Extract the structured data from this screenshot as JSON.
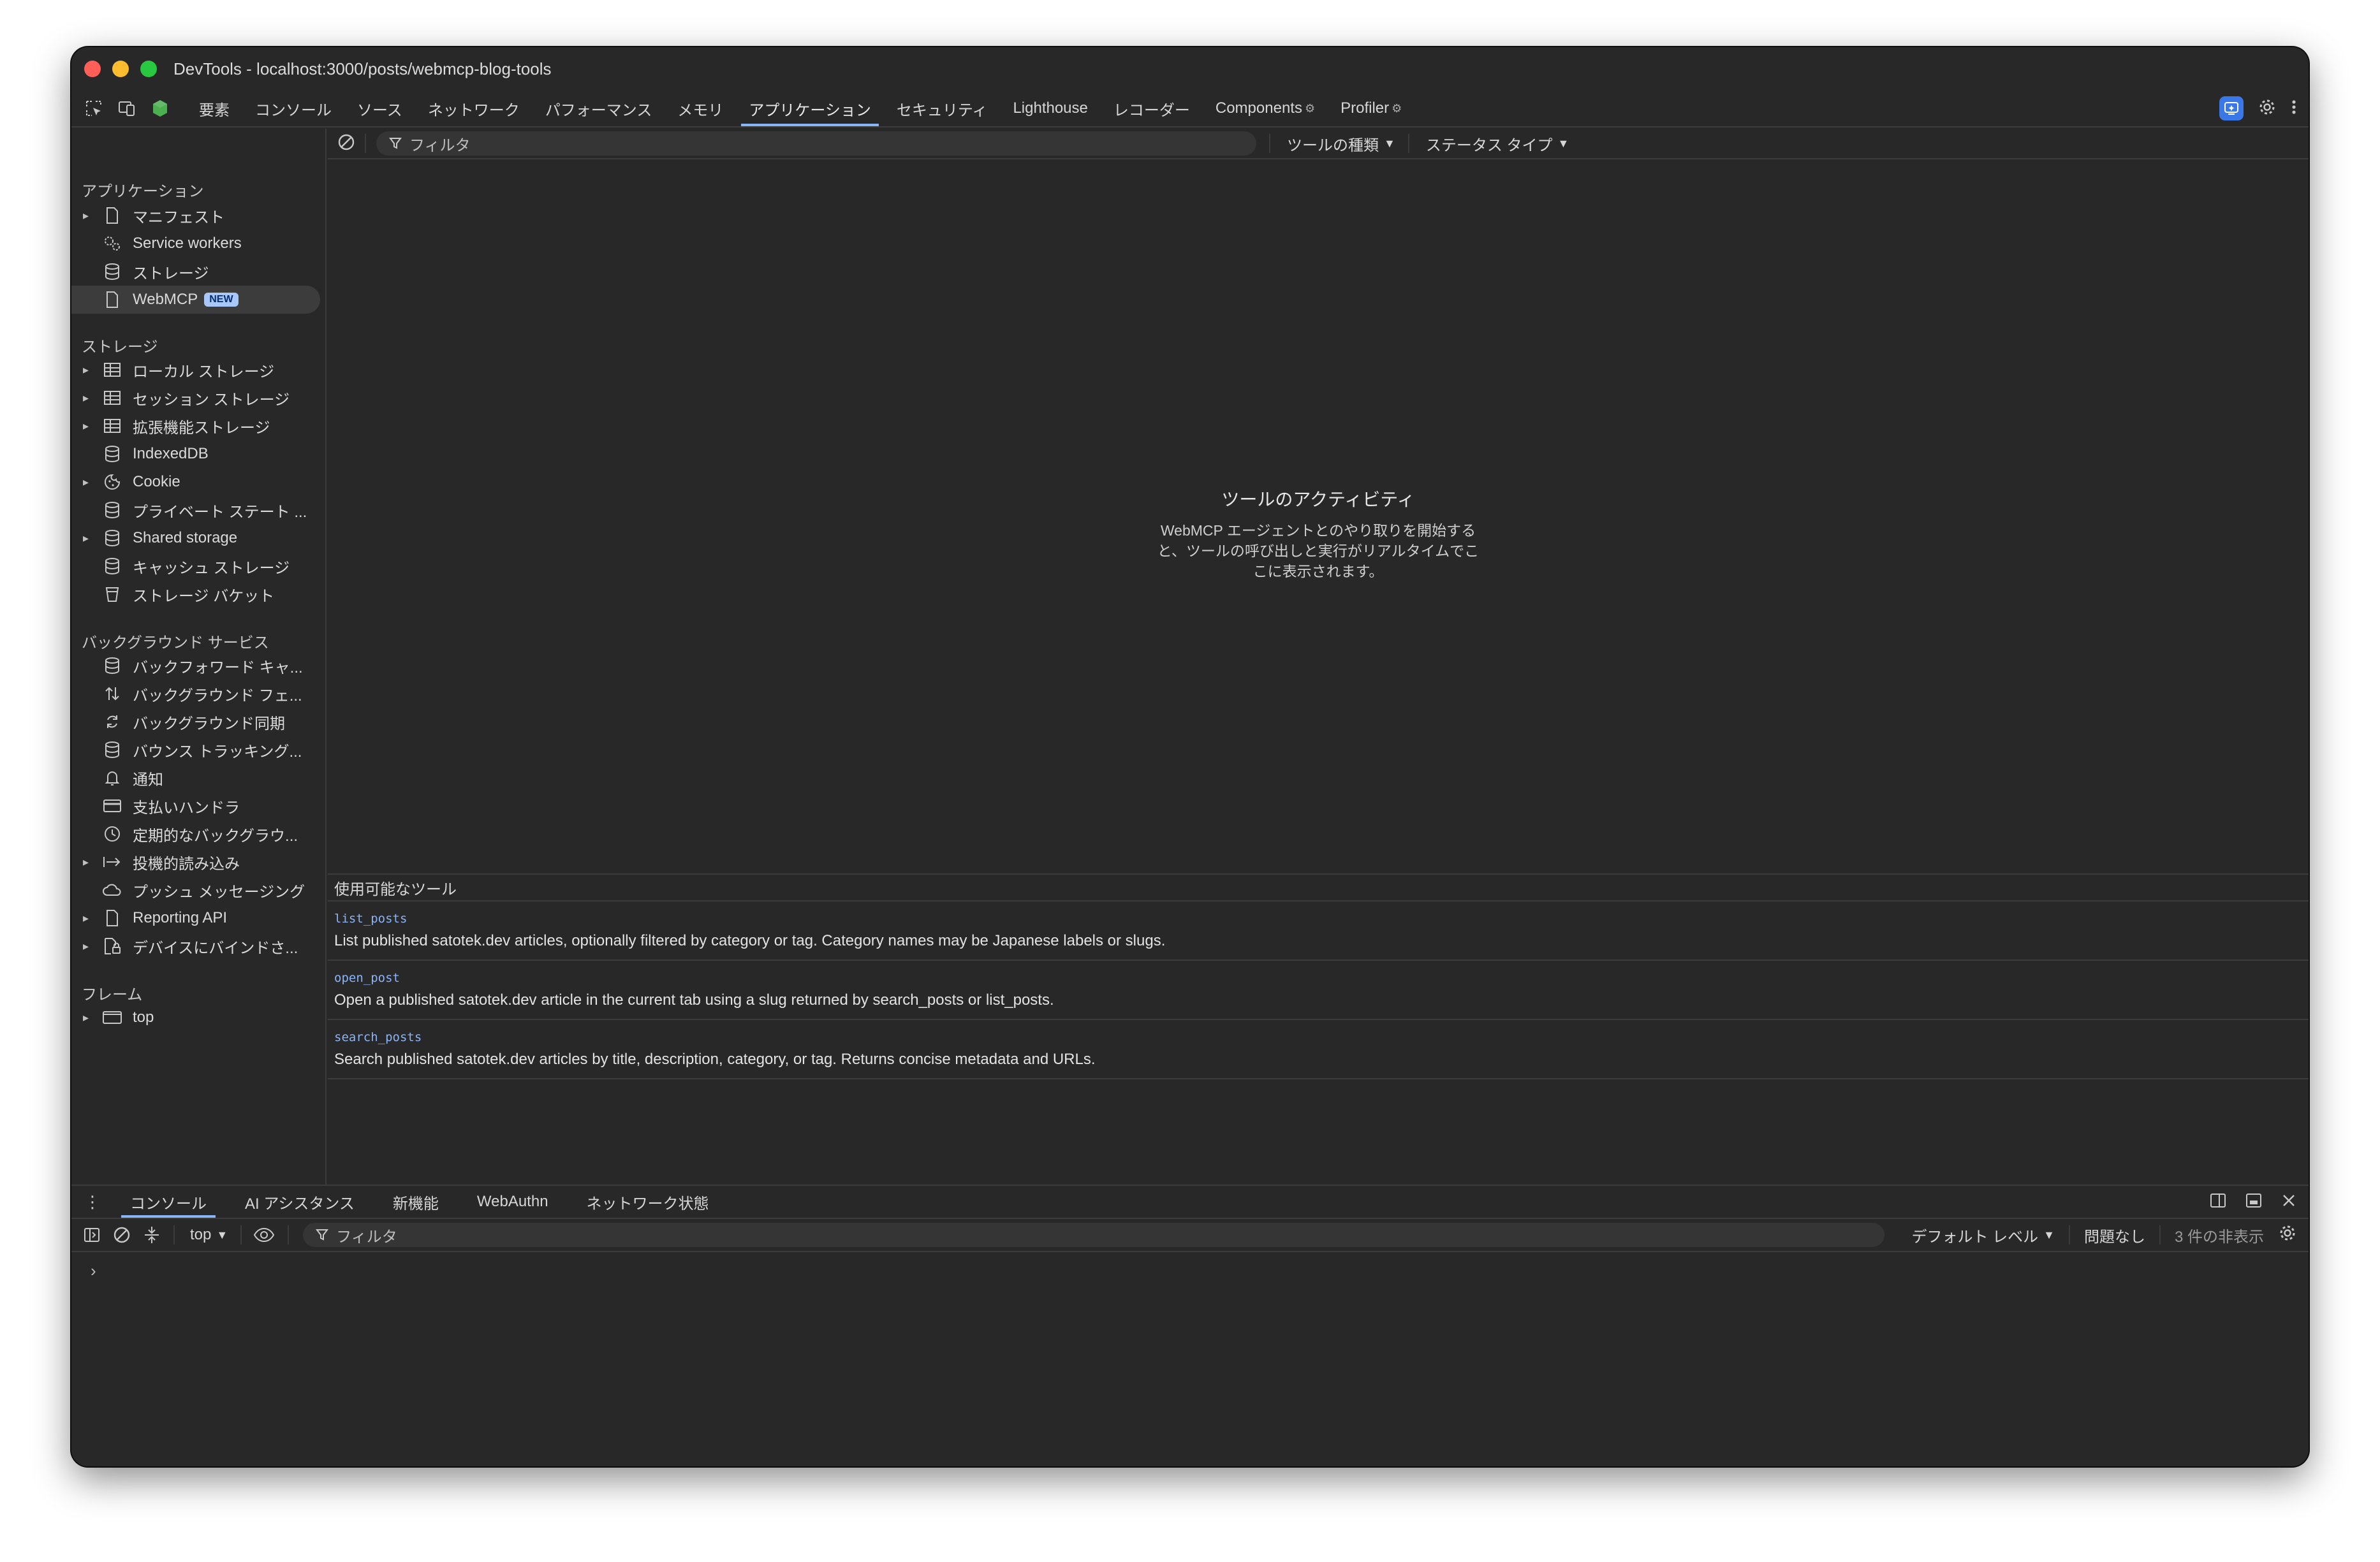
{
  "window": {
    "title": "DevTools - localhost:3000/posts/webmcp-blog-tools"
  },
  "main_tabs": [
    {
      "label": "要素",
      "active": false
    },
    {
      "label": "コンソール",
      "active": false
    },
    {
      "label": "ソース",
      "active": false
    },
    {
      "label": "ネットワーク",
      "active": false
    },
    {
      "label": "パフォーマンス",
      "active": false
    },
    {
      "label": "メモリ",
      "active": false
    },
    {
      "label": "アプリケーション",
      "active": true
    },
    {
      "label": "セキュリティ",
      "active": false
    },
    {
      "label": "Lighthouse",
      "active": false
    },
    {
      "label": "レコーダー",
      "active": false
    },
    {
      "label": "Components",
      "active": false
    },
    {
      "label": "Profiler",
      "active": false
    }
  ],
  "sidebar": {
    "sections": [
      {
        "heading": "アプリケーション",
        "items": [
          {
            "label": "マニフェスト",
            "icon": "document-icon",
            "expandable": true
          },
          {
            "label": "Service workers",
            "icon": "gears-icon",
            "expandable": false
          },
          {
            "label": "ストレージ",
            "icon": "database-icon",
            "expandable": false
          },
          {
            "label": "WebMCP",
            "icon": "document-icon",
            "expandable": false,
            "selected": true,
            "badge": "NEW"
          }
        ]
      },
      {
        "heading": "ストレージ",
        "items": [
          {
            "label": "ローカル ストレージ",
            "icon": "table-icon",
            "expandable": true
          },
          {
            "label": "セッション ストレージ",
            "icon": "table-icon",
            "expandable": true
          },
          {
            "label": "拡張機能ストレージ",
            "icon": "table-icon",
            "expandable": true
          },
          {
            "label": "IndexedDB",
            "icon": "database-icon",
            "expandable": false
          },
          {
            "label": "Cookie",
            "icon": "cookie-icon",
            "expandable": true
          },
          {
            "label": "プライベート ステート ...",
            "icon": "database-icon",
            "expandable": false
          },
          {
            "label": "Shared storage",
            "icon": "database-icon",
            "expandable": true
          },
          {
            "label": "キャッシュ ストレージ",
            "icon": "database-icon",
            "expandable": false
          },
          {
            "label": "ストレージ バケット",
            "icon": "bucket-icon",
            "expandable": false
          }
        ]
      },
      {
        "heading": "バックグラウンド サービス",
        "items": [
          {
            "label": "バックフォワード キャ...",
            "icon": "database-icon",
            "expandable": false
          },
          {
            "label": "バックグラウンド フェ...",
            "icon": "arrows-updown-icon",
            "expandable": false
          },
          {
            "label": "バックグラウンド同期",
            "icon": "sync-icon",
            "expandable": false
          },
          {
            "label": "バウンス トラッキング...",
            "icon": "database-icon",
            "expandable": false
          },
          {
            "label": "通知",
            "icon": "bell-icon",
            "expandable": false
          },
          {
            "label": "支払いハンドラ",
            "icon": "card-icon",
            "expandable": false
          },
          {
            "label": "定期的なバックグラウ...",
            "icon": "clock-icon",
            "expandable": false
          },
          {
            "label": "投機的読み込み",
            "icon": "arrow-right-bar-icon",
            "expandable": true
          },
          {
            "label": "プッシュ メッセージング",
            "icon": "cloud-icon",
            "expandable": false
          },
          {
            "label": "Reporting API",
            "icon": "document-icon",
            "expandable": true
          },
          {
            "label": "デバイスにバインドさ...",
            "icon": "lock-doc-icon",
            "expandable": true
          }
        ]
      },
      {
        "heading": "フレーム",
        "items": [
          {
            "label": "top",
            "icon": "frame-icon",
            "expandable": true
          }
        ]
      }
    ]
  },
  "toolbar": {
    "filter_placeholder": "フィルタ",
    "tool_type_label": "ツールの種類",
    "status_type_label": "ステータス タイプ"
  },
  "activity": {
    "title": "ツールのアクティビティ",
    "description": "WebMCP エージェントとのやり取りを開始すると、ツールの呼び出しと実行がリアルタイムでここに表示されます。"
  },
  "tools": {
    "heading": "使用可能なツール",
    "list": [
      {
        "name": "list_posts",
        "description": "List published satotek.dev articles, optionally filtered by category or tag. Category names may be Japanese labels or slugs."
      },
      {
        "name": "open_post",
        "description": "Open a published satotek.dev article in the current tab using a slug returned by search_posts or list_posts."
      },
      {
        "name": "search_posts",
        "description": "Search published satotek.dev articles by title, description, category, or tag. Returns concise metadata and URLs."
      }
    ]
  },
  "drawer": {
    "tabs": [
      {
        "label": "コンソール",
        "active": true
      },
      {
        "label": "AI アシスタンス",
        "active": false
      },
      {
        "label": "新機能",
        "active": false
      },
      {
        "label": "WebAuthn",
        "active": false
      },
      {
        "label": "ネットワーク状態",
        "active": false
      }
    ],
    "console": {
      "context": "top",
      "filter_placeholder": "フィルタ",
      "level": "デフォルト レベル",
      "issues": "問題なし",
      "hidden": "3 件の非表示",
      "prompt": "›"
    }
  },
  "colors": {
    "accent": "#8ab4f8",
    "background": "#282828",
    "border": "#3c3c3c"
  }
}
